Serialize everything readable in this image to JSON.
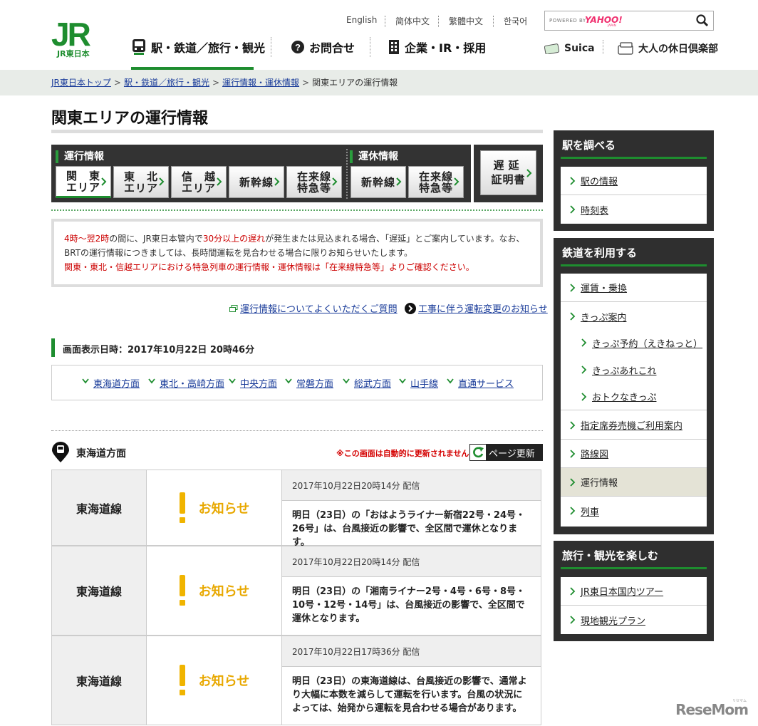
{
  "header": {
    "logo_text": "JR",
    "logo_sub": "JR東日本",
    "languages": [
      "English",
      "简体中文",
      "繁體中文",
      "한국어"
    ],
    "search": {
      "powered_by": "POWERED BY",
      "brand": "YAHOO!",
      "brand_sub": "JAPAN"
    },
    "nav": [
      {
        "label": "駅・鉄道／旅行・観光",
        "icon": "train-icon"
      },
      {
        "label": "お問合せ",
        "icon": "question-icon"
      },
      {
        "label": "企業・IR・採用",
        "icon": "building-icon"
      }
    ],
    "extras": [
      {
        "label": "Suica",
        "icon": "suica-card-icon"
      },
      {
        "label": "大人の休日倶楽部",
        "icon": "card-icon"
      }
    ]
  },
  "breadcrumb": {
    "links": [
      "JR東日本トップ",
      "駅・鉄道／旅行・観光",
      "運行情報・運休情報"
    ],
    "current": "関東エリアの運行情報",
    "sep": ">"
  },
  "page_title": "関東エリアの運行情報",
  "tabs": {
    "operation_head": "運行情報",
    "operation": [
      {
        "l1": "関　東",
        "l2": "エリア"
      },
      {
        "l1": "東　北",
        "l2": "エリア"
      },
      {
        "l1": "信　越",
        "l2": "エリア"
      },
      {
        "l1": "新幹線",
        "l2": ""
      },
      {
        "l1": "在来線",
        "l2": "特急等"
      }
    ],
    "suspension_head": "運休情報",
    "suspension": [
      {
        "l1": "新幹線",
        "l2": ""
      },
      {
        "l1": "在来線",
        "l2": "特急等"
      }
    ],
    "delay": {
      "l1": "遅延",
      "l2": "証明書"
    }
  },
  "notice": {
    "p1_a": "4時～翌2時",
    "p1_b": "の間に、JR東日本管内で",
    "p1_c": "30分以上の遅れ",
    "p1_d": "が発生または見込まれる場合、「遅延」とご案内しています。なお、BRTの運行情報につきましては、長時間運転を見合わせる場合に限りお知らせいたします。",
    "p2": "関東・東北・信越エリアにおける特急列車の運行情報・運休情報は「在来線特急等」よりご確認ください。"
  },
  "links": {
    "faq": "運行情報についてよくいただくご質問",
    "construction": "工事に伴う運転変更のお知らせ"
  },
  "datetime": "画面表示日時：2017年10月22日 20時46分",
  "directions": [
    "東海道方面",
    "東北・高崎方面",
    "中央方面",
    "常磐方面",
    "総武方面",
    "山手線",
    "直通サービス"
  ],
  "section": {
    "title": "東海道方面",
    "auto_note": "※この画面は自動的に更新されません",
    "refresh": "ページ更新"
  },
  "rows": [
    {
      "line": "東海道線",
      "status": "お知らせ",
      "time": "2017年10月22日20時14分 配信",
      "message": "明日（23日）の「おはようライナー新宿22号・24号・26号」は、台風接近の影響で、全区間で運休となります。"
    },
    {
      "line": "東海道線",
      "status": "お知らせ",
      "time": "2017年10月22日20時14分 配信",
      "message": "明日（23日）の「湘南ライナー2号・4号・6号・8号・10号・12号・14号」は、台風接近の影響で、全区間で運休となります。"
    },
    {
      "line": "東海道線",
      "status": "お知らせ",
      "time": "2017年10月22日17時36分 配信",
      "message": "明日（23日）の東海道線は、台風接近の影響で、通常より大幅に本数を減らして運転を行います。台風の状況によっては、始発から運転を見合わせる場合があります。"
    }
  ],
  "sidebar": {
    "stations": {
      "title": "駅を調べる",
      "items": [
        "駅の情報",
        "時刻表"
      ]
    },
    "rail": {
      "title": "鉄道を利用する",
      "items": [
        "運賃・乗換",
        "きっぷ案内",
        "きっぷ予約（えきねっと）",
        "きっぷあれこれ",
        "おトクなきっぷ",
        "指定席券売機ご利用案内",
        "路線図",
        "運行情報",
        "列車"
      ]
    },
    "travel": {
      "title": "旅行・観光を楽しむ",
      "items": [
        "JR東日本国内ツアー",
        "現地観光プラン"
      ]
    }
  },
  "watermark": {
    "text": "ReseMom",
    "sub": "リセマム"
  },
  "colors": {
    "brand_green": "#1e8d2f",
    "notice_red": "#cc0000",
    "status_yellow": "#f0b400",
    "sidebar_dark": "#2f2f2f"
  }
}
